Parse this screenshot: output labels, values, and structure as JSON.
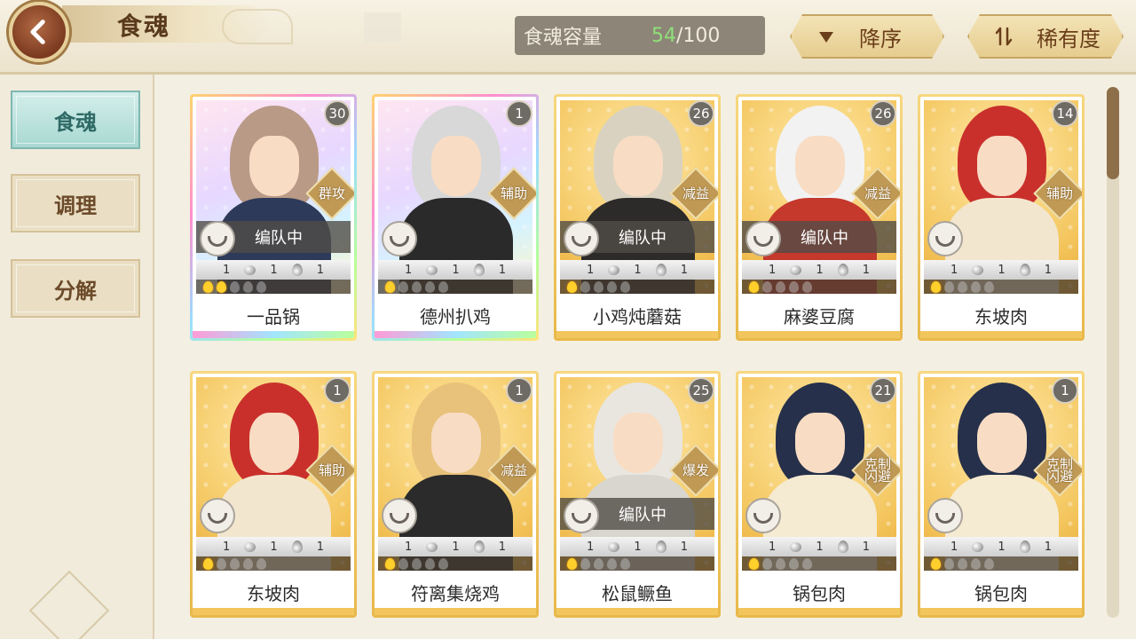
{
  "header": {
    "title": "食魂",
    "capacity_label": "食魂容量",
    "capacity_current": "54",
    "capacity_max": "/100",
    "sort_order": "降序",
    "sort_rarity": "稀有度"
  },
  "sidebar": {
    "items": [
      {
        "label": "食魂"
      },
      {
        "label": "调理"
      },
      {
        "label": "分解"
      }
    ]
  },
  "cards": [
    {
      "name": "一品锅",
      "level": "30",
      "role": "群攻",
      "team": "编队中",
      "rarity": "rainbow",
      "s1": "1",
      "s2": "1",
      "s3": "1",
      "flames": 2,
      "hair": "#b89a86",
      "body": "#2e3a5a"
    },
    {
      "name": "德州扒鸡",
      "level": "1",
      "role": "辅助",
      "team": "",
      "rarity": "rainbow",
      "s1": "1",
      "s2": "1",
      "s3": "1",
      "flames": 1,
      "hair": "#d8d8d8",
      "body": "#2a2a2a"
    },
    {
      "name": "小鸡炖蘑菇",
      "level": "26",
      "role": "减益",
      "team": "编队中",
      "rarity": "gold",
      "s1": "1",
      "s2": "1",
      "s3": "1",
      "flames": 1,
      "hair": "#d9d2c0",
      "body": "#2d2a2a"
    },
    {
      "name": "麻婆豆腐",
      "level": "26",
      "role": "减益",
      "team": "编队中",
      "rarity": "gold",
      "s1": "1",
      "s2": "1",
      "s3": "1",
      "flames": 1,
      "hair": "#f2f2f2",
      "body": "#c5382c"
    },
    {
      "name": "东坡肉",
      "level": "14",
      "role": "辅助",
      "team": "",
      "rarity": "gold",
      "s1": "1",
      "s2": "1",
      "s3": "1",
      "flames": 1,
      "hair": "#c9302c",
      "body": "#f3e6cf"
    },
    {
      "name": "东坡肉",
      "level": "1",
      "role": "辅助",
      "team": "",
      "rarity": "gold",
      "s1": "1",
      "s2": "1",
      "s3": "1",
      "flames": 1,
      "hair": "#c9302c",
      "body": "#f3e6cf"
    },
    {
      "name": "符离集烧鸡",
      "level": "1",
      "role": "减益",
      "team": "",
      "rarity": "gold",
      "s1": "1",
      "s2": "1",
      "s3": "1",
      "flames": 1,
      "hair": "#e8c27a",
      "body": "#2b2b2b"
    },
    {
      "name": "松鼠鳜鱼",
      "level": "25",
      "role": "爆发",
      "team": "编队中",
      "rarity": "gold",
      "s1": "1",
      "s2": "1",
      "s3": "1",
      "flames": 1,
      "hair": "#e9e6e0",
      "body": "#d9d6cf"
    },
    {
      "name": "锅包肉",
      "level": "21",
      "role": "克制 闪避",
      "team": "",
      "rarity": "gold",
      "s1": "1",
      "s2": "1",
      "s3": "1",
      "flames": 1,
      "hair": "#26304a",
      "body": "#f5ead2"
    },
    {
      "name": "锅包肉",
      "level": "1",
      "role": "克制 闪避",
      "team": "",
      "rarity": "gold",
      "s1": "1",
      "s2": "1",
      "s3": "1",
      "flames": 1,
      "hair": "#26304a",
      "body": "#f5ead2"
    }
  ]
}
